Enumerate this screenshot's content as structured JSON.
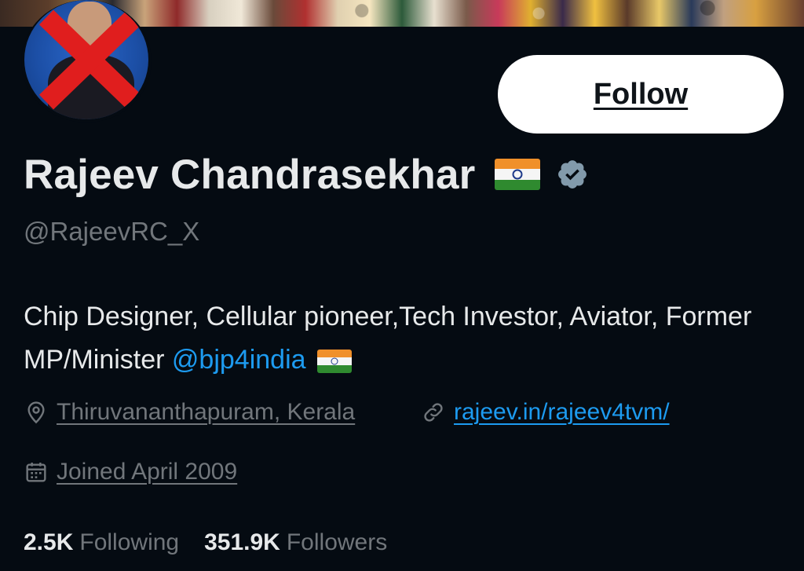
{
  "banner": {},
  "avatar": {},
  "follow_button": {
    "label": "Follow"
  },
  "profile": {
    "name": "Rajeev Chandrasekhar",
    "handle": "@RajeevRC_X",
    "bio_text": "Chip Designer, Cellular pioneer,Tech Investor, Aviator, Former MP/Minister ",
    "bio_mention": "@bjp4india",
    "location": "Thiruvananthapuram, Kerala",
    "website": "rajeev.in/rajeev4tvm/",
    "joined": "Joined April 2009"
  },
  "stats": {
    "following_count": "2.5K",
    "following_label": "Following",
    "followers_count": "351.9K",
    "followers_label": "Followers"
  },
  "icons": {
    "verified": "verified-badge-icon",
    "location": "location-pin-icon",
    "link": "link-icon",
    "calendar": "calendar-icon",
    "flag": "india-flag-icon"
  },
  "colors": {
    "background": "#050b12",
    "text_primary": "#e7e9ea",
    "text_secondary": "#71767b",
    "accent": "#1d9bf0",
    "verified": "#829aab"
  }
}
